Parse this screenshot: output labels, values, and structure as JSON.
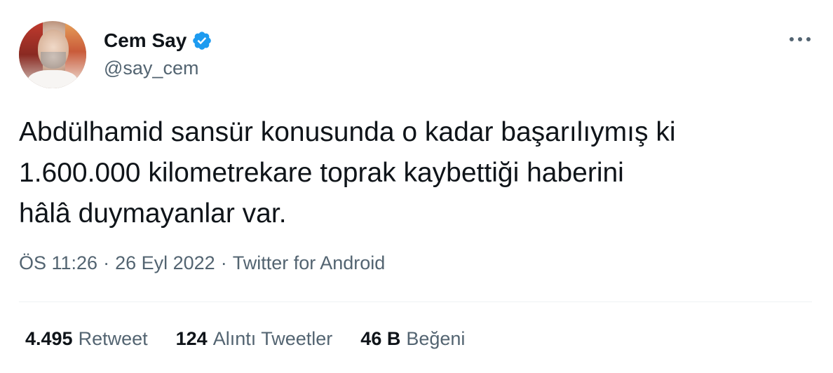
{
  "author": {
    "display_name": "Cem Say",
    "handle": "@say_cem",
    "verified": true,
    "verified_color": "#1d9bf0"
  },
  "tweet": {
    "text": "Abdülhamid sansür konusunda o kadar başarılıymış ki\n1.600.000 kilometrekare toprak kaybettiği haberini\nhâlâ duymayanlar var."
  },
  "meta": {
    "time": "ÖS 11:26",
    "sep1": "·",
    "date": "26 Eyl 2022",
    "sep2": "·",
    "source": "Twitter for Android"
  },
  "stats": {
    "retweets": {
      "count": "4.495",
      "label": "Retweet"
    },
    "quotes": {
      "count": "124",
      "label": "Alıntı Tweetler"
    },
    "likes": {
      "count": "46 B",
      "label": "Beğeni"
    }
  },
  "icons": {
    "more": "more-horizontal-icon",
    "verified": "verified-badge-icon"
  }
}
